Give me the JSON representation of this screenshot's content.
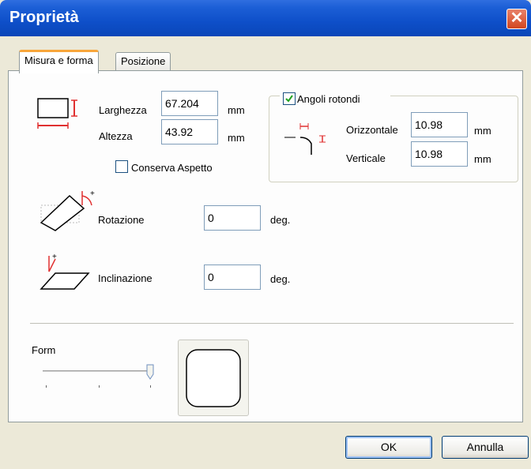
{
  "window": {
    "title": "Proprietà"
  },
  "tabs": [
    {
      "label": "Misura e forma"
    },
    {
      "label": "Posizione"
    }
  ],
  "size": {
    "width_label": "Larghezza",
    "width_value": "67.204",
    "width_unit": "mm",
    "height_label": "Altezza",
    "height_value": "43.92",
    "height_unit": "mm",
    "keep_aspect_label": "Conserva Aspetto",
    "keep_aspect_checked": false
  },
  "rounded": {
    "label": "Angoli rotondi",
    "checked": true,
    "horizontal_label": "Orizzontale",
    "horizontal_value": "10.98",
    "horizontal_unit": "mm",
    "vertical_label": "Verticale",
    "vertical_value": "10.98",
    "vertical_unit": "mm"
  },
  "rotation": {
    "label": "Rotazione",
    "value": "0",
    "unit": "deg."
  },
  "skew": {
    "label": "Inclinazione",
    "value": "0",
    "unit": "deg."
  },
  "form": {
    "label": "Form"
  },
  "buttons": {
    "ok": "OK",
    "cancel": "Annulla"
  },
  "colors": {
    "accent_red": "#e03030",
    "titlebar": "#0a46b8",
    "tab_highlight": "#f8a63a"
  }
}
